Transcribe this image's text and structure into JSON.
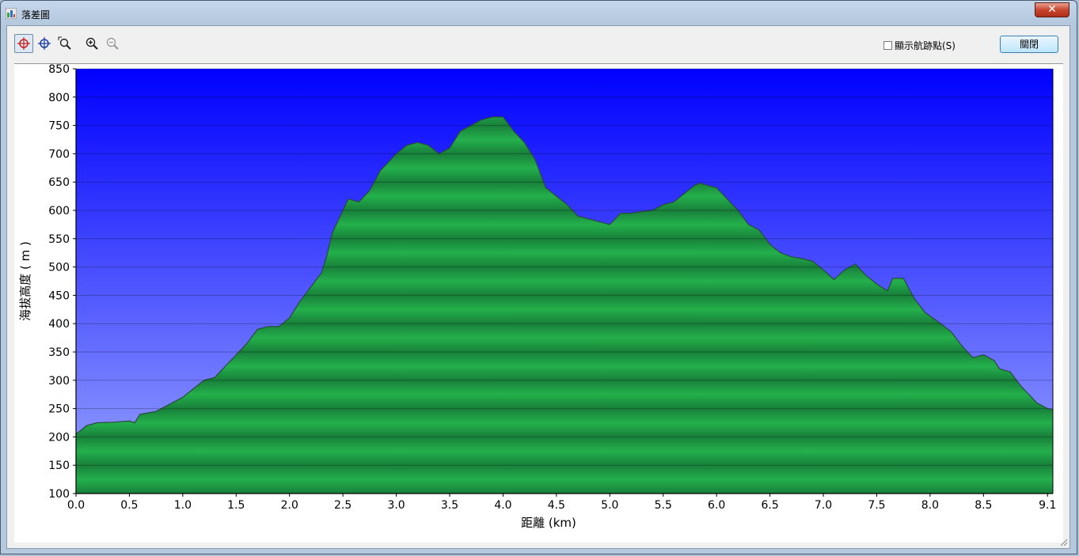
{
  "window": {
    "title": "落差圖",
    "close_symbol": "✕"
  },
  "toolbar": {
    "buttons": [
      {
        "name": "crosshair-red-icon",
        "active": true
      },
      {
        "name": "crosshair-blue-icon",
        "active": false
      },
      {
        "name": "zoom-select-icon",
        "active": false
      },
      {
        "name": "zoom-in-icon",
        "active": false
      },
      {
        "name": "zoom-out-icon",
        "active": false
      }
    ],
    "show_waypoints_label": "顯示航跡點(S)",
    "show_waypoints_checked": false,
    "close_label": "關閉"
  },
  "colors": {
    "sky_top": "#0000ff",
    "sky_bottom": "#9aa6ff",
    "terrain_light": "#24b04c",
    "terrain_dark": "#18803a",
    "outline": "#2a4a3a"
  },
  "chart_data": {
    "type": "area",
    "xlabel": "距離 (km)",
    "ylabel": "海拔高度 ( m )",
    "xlim": [
      0,
      9.15
    ],
    "ylim": [
      100,
      850
    ],
    "x_ticks": [
      "0.0",
      "0.5",
      "1.0",
      "1.5",
      "2.0",
      "2.5",
      "3.0",
      "3.5",
      "4.0",
      "4.5",
      "5.0",
      "5.5",
      "6.0",
      "6.5",
      "7.0",
      "7.5",
      "8.0",
      "8.5",
      "9.1"
    ],
    "y_ticks": [
      "850",
      "800",
      "750",
      "700",
      "650",
      "600",
      "550",
      "500",
      "450",
      "400",
      "350",
      "300",
      "250",
      "200",
      "150",
      "100"
    ],
    "grid": true,
    "series": [
      {
        "points": [
          [
            0.0,
            205
          ],
          [
            0.1,
            220
          ],
          [
            0.2,
            225
          ],
          [
            0.35,
            226
          ],
          [
            0.5,
            228
          ],
          [
            0.55,
            225
          ],
          [
            0.6,
            240
          ],
          [
            0.75,
            245
          ],
          [
            0.85,
            255
          ],
          [
            1.0,
            270
          ],
          [
            1.1,
            285
          ],
          [
            1.2,
            300
          ],
          [
            1.3,
            305
          ],
          [
            1.4,
            325
          ],
          [
            1.5,
            345
          ],
          [
            1.6,
            365
          ],
          [
            1.7,
            390
          ],
          [
            1.8,
            395
          ],
          [
            1.9,
            395
          ],
          [
            2.0,
            410
          ],
          [
            2.1,
            440
          ],
          [
            2.2,
            465
          ],
          [
            2.3,
            490
          ],
          [
            2.35,
            520
          ],
          [
            2.4,
            560
          ],
          [
            2.5,
            600
          ],
          [
            2.55,
            620
          ],
          [
            2.65,
            615
          ],
          [
            2.75,
            635
          ],
          [
            2.85,
            670
          ],
          [
            3.0,
            700
          ],
          [
            3.1,
            715
          ],
          [
            3.2,
            720
          ],
          [
            3.3,
            715
          ],
          [
            3.4,
            700
          ],
          [
            3.5,
            710
          ],
          [
            3.6,
            740
          ],
          [
            3.7,
            750
          ],
          [
            3.8,
            760
          ],
          [
            3.9,
            765
          ],
          [
            4.0,
            765
          ],
          [
            4.1,
            740
          ],
          [
            4.2,
            720
          ],
          [
            4.3,
            690
          ],
          [
            4.4,
            640
          ],
          [
            4.5,
            625
          ],
          [
            4.6,
            610
          ],
          [
            4.7,
            590
          ],
          [
            4.8,
            585
          ],
          [
            4.9,
            580
          ],
          [
            5.0,
            575
          ],
          [
            5.1,
            595
          ],
          [
            5.2,
            595
          ],
          [
            5.3,
            598
          ],
          [
            5.4,
            600
          ],
          [
            5.5,
            610
          ],
          [
            5.6,
            615
          ],
          [
            5.7,
            630
          ],
          [
            5.8,
            645
          ],
          [
            5.85,
            648
          ],
          [
            5.9,
            645
          ],
          [
            6.0,
            640
          ],
          [
            6.1,
            620
          ],
          [
            6.2,
            600
          ],
          [
            6.3,
            575
          ],
          [
            6.4,
            565
          ],
          [
            6.5,
            540
          ],
          [
            6.6,
            525
          ],
          [
            6.7,
            518
          ],
          [
            6.8,
            515
          ],
          [
            6.9,
            510
          ],
          [
            7.0,
            495
          ],
          [
            7.1,
            478
          ],
          [
            7.2,
            495
          ],
          [
            7.3,
            505
          ],
          [
            7.4,
            485
          ],
          [
            7.5,
            470
          ],
          [
            7.6,
            458
          ],
          [
            7.65,
            480
          ],
          [
            7.75,
            480
          ],
          [
            7.85,
            445
          ],
          [
            7.95,
            420
          ],
          [
            8.1,
            400
          ],
          [
            8.2,
            385
          ],
          [
            8.3,
            360
          ],
          [
            8.4,
            340
          ],
          [
            8.5,
            345
          ],
          [
            8.6,
            335
          ],
          [
            8.65,
            320
          ],
          [
            8.75,
            315
          ],
          [
            8.85,
            290
          ],
          [
            9.0,
            260
          ],
          [
            9.1,
            250
          ],
          [
            9.15,
            248
          ]
        ]
      }
    ]
  }
}
